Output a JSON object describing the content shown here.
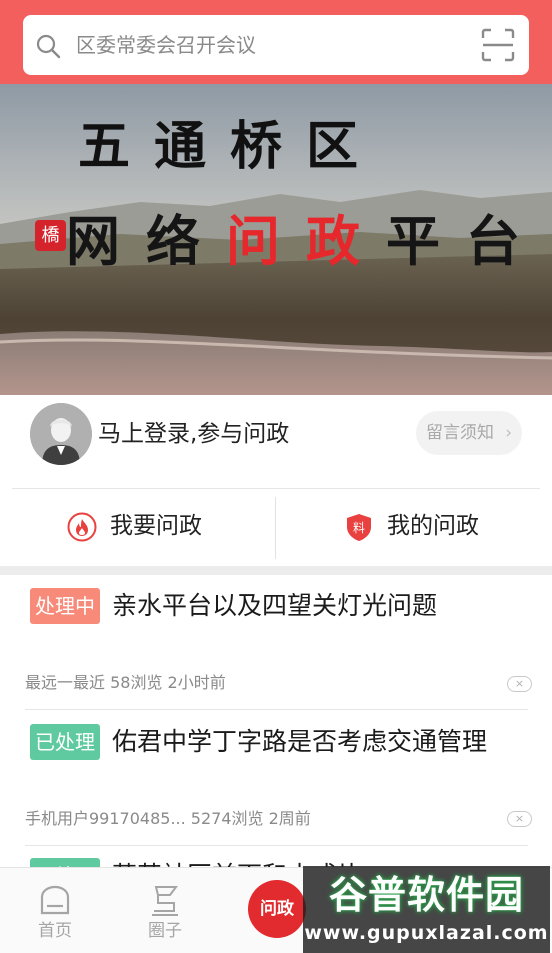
{
  "search": {
    "placeholder": "区委常委会召开会议"
  },
  "banner": {
    "seal": "橋",
    "line1": "五通桥区",
    "line2_a": "网络",
    "line2_b": "问政",
    "line2_c": "平台"
  },
  "login": {
    "prompt": "马上登录,参与问政",
    "notice_label": "留言须知",
    "notice_chevron": "›"
  },
  "actions": {
    "ask_label": "我要问政",
    "mine_label": "我的问政"
  },
  "feed": [
    {
      "status": "处理中",
      "title": "亲水平台以及四望关灯光问题",
      "meta": "最远一最近  58浏览  2小时前",
      "close": "×"
    },
    {
      "status": "已处理",
      "title": "佑君中学丁字路是否考虑交通管理",
      "meta": "手机用户99170485...  5274浏览  2周前",
      "close": "×"
    },
    {
      "status": "已处理",
      "title": "茅英社区前面和水成片"
    }
  ],
  "tabbar": {
    "home_label": "首页",
    "circle_label": "圈子",
    "center_label": "问政"
  },
  "watermark": {
    "title": "谷普软件园",
    "url": "www.gupuxlazal.com"
  },
  "colors": {
    "header": "#f25f5c",
    "accent_red": "#e12b2e",
    "status_processing": "#f78a79",
    "status_done": "#5fcaa0"
  }
}
